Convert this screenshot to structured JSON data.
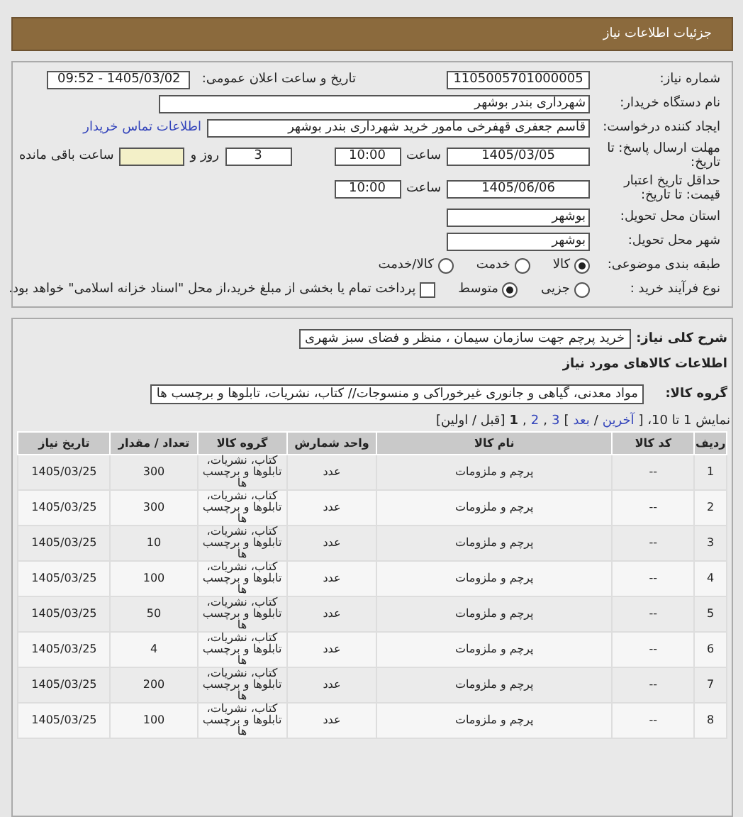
{
  "header": {
    "title": "جزئیات اطلاعات نیاز"
  },
  "details": {
    "need_number": {
      "label": "شماره نیاز:",
      "value": "1105005701000005"
    },
    "announce": {
      "label": "تاریخ و ساعت اعلان عمومی:",
      "value": "1405/03/02 - 09:52"
    },
    "buyer": {
      "label": "نام دستگاه خریدار:",
      "value": "شهرداری بندر بوشهر"
    },
    "creator": {
      "label": "ایجاد کننده درخواست:",
      "value": "قاسم جعفری قهفرخی مامور خرید  شهرداری بندر بوشهر",
      "link": "اطلاعات تماس خریدار"
    },
    "deadline": {
      "label": "مهلت ارسال پاسخ: تا تاریخ:",
      "date": "1405/03/05",
      "time_label": "ساعت",
      "time": "10:00",
      "days": "3",
      "days_label": "روز و",
      "remaining_label": "ساعت باقی مانده"
    },
    "validity": {
      "label": "حداقل تاریخ اعتبار قیمت: تا تاریخ:",
      "date": "1405/06/06",
      "time_label": "ساعت",
      "time": "10:00"
    },
    "province": {
      "label": "استان محل تحویل:",
      "value": "بوشهر"
    },
    "city": {
      "label": "شهر محل تحویل:",
      "value": "بوشهر"
    },
    "category": {
      "label": "طبقه بندی موضوعی:",
      "options": [
        {
          "label": "کالا",
          "selected": true
        },
        {
          "label": "خدمت",
          "selected": false
        },
        {
          "label": "کالا/خدمت",
          "selected": false
        }
      ]
    },
    "process": {
      "label": "نوع فرآیند خرید :",
      "options": [
        {
          "label": "جزیی",
          "selected": false
        },
        {
          "label": "متوسط",
          "selected": true
        }
      ],
      "treasury": {
        "label": "پرداخت تمام یا بخشی از مبلغ خرید،از محل \"اسناد خزانه اسلامی\" خواهد بود.",
        "checked": false
      }
    }
  },
  "summary": {
    "label": "شرح کلی نیاز:",
    "value": "خرید پرچم جهت سازمان سیمان ، منظر و فضای سبز شهری"
  },
  "goods_title": "اطلاعات کالاهای مورد نیاز",
  "goods_group": {
    "label": "گروه کالا:",
    "value": "مواد معدنی، گیاهی و جانوری غیرخوراکی و منسوجات// کتاب، نشریات، تابلوها و برچسب ها"
  },
  "pagination": [
    {
      "kind": "text",
      "text": "نمایش 1 تا 10، ["
    },
    {
      "kind": "link",
      "text": "آخرین"
    },
    {
      "kind": "text",
      "text": "/"
    },
    {
      "kind": "link",
      "text": "بعد"
    },
    {
      "kind": "text",
      "text": "]"
    },
    {
      "kind": "link",
      "text": "3"
    },
    {
      "kind": "text",
      "text": ","
    },
    {
      "kind": "link",
      "text": "2"
    },
    {
      "kind": "text",
      "text": ","
    },
    {
      "kind": "current",
      "text": "1"
    },
    {
      "kind": "text",
      "text": "[قبل / اولین]"
    }
  ],
  "table": {
    "columns": [
      "ردیف",
      "کد کالا",
      "نام کالا",
      "واحد شمارش",
      "گروه کالا",
      "تعداد / مقدار",
      "تاریخ نیاز"
    ],
    "rows": [
      [
        "1",
        "--",
        "پرچم و ملزومات",
        "عدد",
        "کتاب، نشریات، تابلوها و برچسب ها",
        "300",
        "1405/03/25"
      ],
      [
        "2",
        "--",
        "پرچم و ملزومات",
        "عدد",
        "کتاب، نشریات، تابلوها و برچسب ها",
        "300",
        "1405/03/25"
      ],
      [
        "3",
        "--",
        "پرچم و ملزومات",
        "عدد",
        "کتاب، نشریات، تابلوها و برچسب ها",
        "10",
        "1405/03/25"
      ],
      [
        "4",
        "--",
        "پرچم و ملزومات",
        "عدد",
        "کتاب، نشریات، تابلوها و برچسب ها",
        "100",
        "1405/03/25"
      ],
      [
        "5",
        "--",
        "پرچم و ملزومات",
        "عدد",
        "کتاب، نشریات، تابلوها و برچسب ها",
        "50",
        "1405/03/25"
      ],
      [
        "6",
        "--",
        "پرچم و ملزومات",
        "عدد",
        "کتاب، نشریات، تابلوها و برچسب ها",
        "4",
        "1405/03/25"
      ],
      [
        "7",
        "--",
        "پرچم و ملزومات",
        "عدد",
        "کتاب، نشریات، تابلوها و برچسب ها",
        "200",
        "1405/03/25"
      ],
      [
        "8",
        "--",
        "پرچم و ملزومات",
        "عدد",
        "کتاب، نشریات، تابلوها و برچسب ها",
        "100",
        "1405/03/25"
      ]
    ]
  }
}
